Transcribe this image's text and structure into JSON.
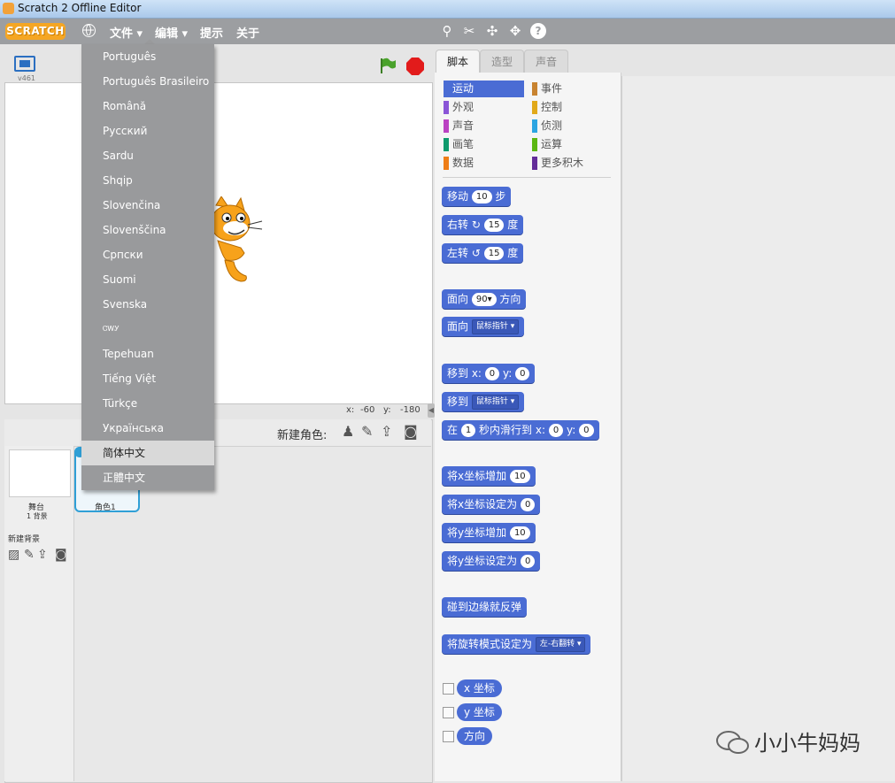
{
  "window": {
    "title": "Scratch 2 Offline Editor"
  },
  "menubar": {
    "logo": "SCRATCH",
    "items": [
      "文件",
      "编辑",
      "提示",
      "关于"
    ]
  },
  "stage": {
    "version": "v461",
    "coords_x_label": "x:",
    "coords_x": "-60",
    "coords_y_label": "y:",
    "coords_y": "-180"
  },
  "sprites": {
    "new_sprite_label": "新建角色:",
    "stage_label": "舞台",
    "stage_backdrops": "1 背景",
    "new_backdrop_label": "新建背景",
    "sprite1_label": "角色1"
  },
  "language_menu": {
    "items": [
      "Português",
      "Português Brasileiro",
      "Română",
      "Русский",
      "Sardu",
      "Shqip",
      "Slovenčina",
      "Slovenščina",
      "Српски",
      "Suomi",
      "Svenska",
      "ᏣᎳᎩ",
      "Tepehuan",
      "Tiếng Việt",
      "Türkçe",
      "Українська",
      "简体中文",
      "正體中文"
    ],
    "highlighted": "简体中文"
  },
  "tabs": [
    "脚本",
    "造型",
    "声音"
  ],
  "categories": [
    {
      "label": "运动",
      "color": "#4a6cd4"
    },
    {
      "label": "事件",
      "color": "#c88330"
    },
    {
      "label": "外观",
      "color": "#8a55d7"
    },
    {
      "label": "控制",
      "color": "#e1a91a"
    },
    {
      "label": "声音",
      "color": "#bb42c3"
    },
    {
      "label": "侦测",
      "color": "#2ca5e2"
    },
    {
      "label": "画笔",
      "color": "#0e9a6c"
    },
    {
      "label": "运算",
      "color": "#5cb712"
    },
    {
      "label": "数据",
      "color": "#ee7d16"
    },
    {
      "label": "更多积木",
      "color": "#632d99"
    }
  ],
  "blocks": {
    "move": {
      "a": "移动",
      "v": "10",
      "b": "步"
    },
    "turn_right": {
      "a": "右转",
      "v": "15",
      "b": "度"
    },
    "turn_left": {
      "a": "左转",
      "v": "15",
      "b": "度"
    },
    "point_dir": {
      "a": "面向",
      "v": "90▾",
      "b": "方向"
    },
    "point_towards": {
      "a": "面向",
      "v": "鼠标指针 ▾"
    },
    "goto_xy": {
      "a": "移到 x:",
      "x": "0",
      "m": "y:",
      "y": "0"
    },
    "goto": {
      "a": "移到",
      "v": "鼠标指针 ▾"
    },
    "glide": {
      "a": "在",
      "s": "1",
      "m": "秒内滑行到 x:",
      "x": "0",
      "n": "y:",
      "y": "0"
    },
    "change_x": {
      "a": "将x坐标增加",
      "v": "10"
    },
    "set_x": {
      "a": "将x坐标设定为",
      "v": "0"
    },
    "change_y": {
      "a": "将y坐标增加",
      "v": "10"
    },
    "set_y": {
      "a": "将y坐标设定为",
      "v": "0"
    },
    "bounce": {
      "a": "碰到边缘就反弹"
    },
    "rot_style": {
      "a": "将旋转模式设定为",
      "v": "左-右翻转 ▾"
    },
    "reporters": [
      "x 坐标",
      "y 坐标",
      "方向"
    ]
  },
  "watermark": "小小牛妈妈"
}
